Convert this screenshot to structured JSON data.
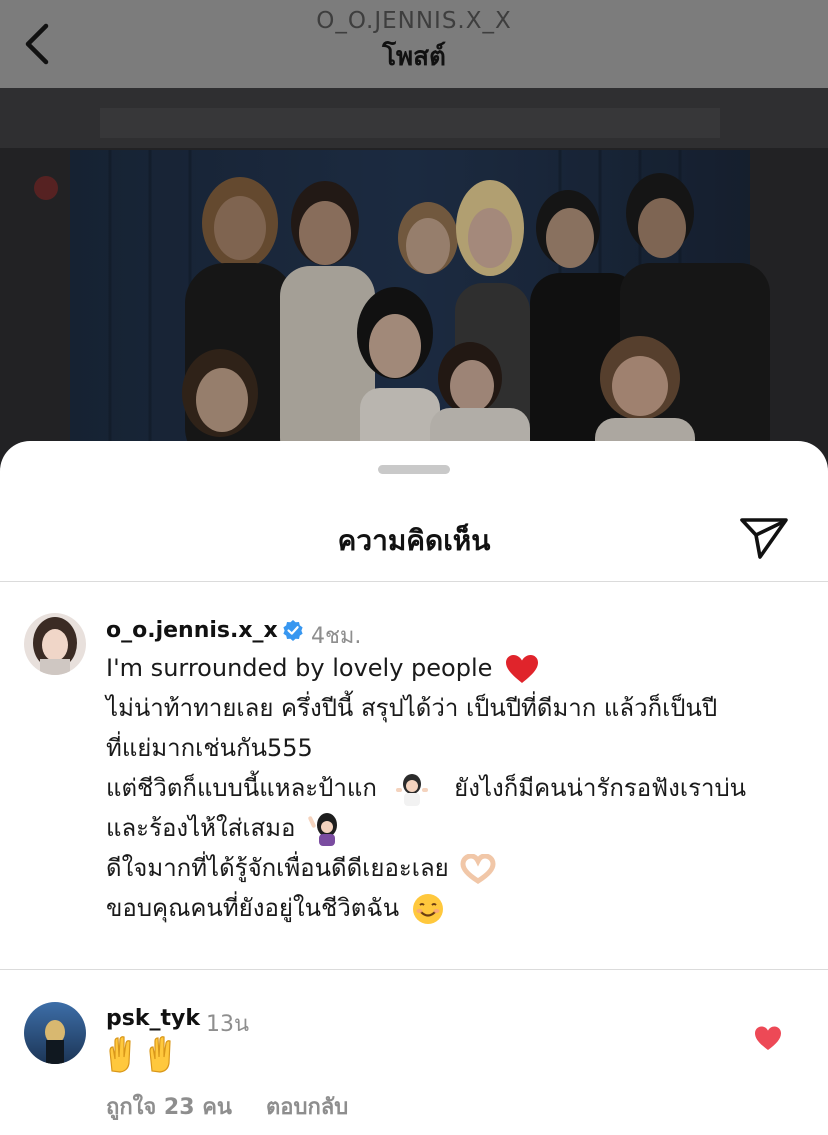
{
  "header": {
    "username": "O_O.JENNIS.X_X",
    "title": "โพสต์"
  },
  "comments_sheet": {
    "title": "ความคิดเห็น"
  },
  "caption": {
    "username": "o_o.jennis.x_x",
    "time": "4ชม.",
    "lines": [
      "I'm surrounded by lovely people",
      "ไม่น่าท้าทายเลย ครึ่งปีนี้ สรุปได้ว่า เป็นปีที่ดีมาก แล้วก็เป็นปี",
      "ที่แย่มากเช่นกัน555",
      "แต่ชีวิตก็แบบนี้แหละป้าแก",
      "ยังไงก็มีคนน่ารักรอฟังเราบ่น",
      "และร้องไห้ใส่เสมอ",
      "ดีใจมากที่ได้รู้จักเพื่อนดีดีเยอะเลย",
      "ขอบคุณคนที่ยังอยู่ในชีวิตฉัน"
    ]
  },
  "comment": {
    "username": "psk_tyk",
    "time": "13น",
    "likes": "ถูกใจ 23 คน",
    "reply": "ตอบกลับ"
  },
  "icons": {
    "back": "chevron-left-icon",
    "share": "paper-plane-icon",
    "verified": "verified-badge-icon",
    "heart": "red-heart-emoji",
    "like": "heart-filled-icon"
  },
  "colors": {
    "verified": "#3897f0",
    "heart": "#ed4956",
    "meta": "#8e8e8e"
  }
}
